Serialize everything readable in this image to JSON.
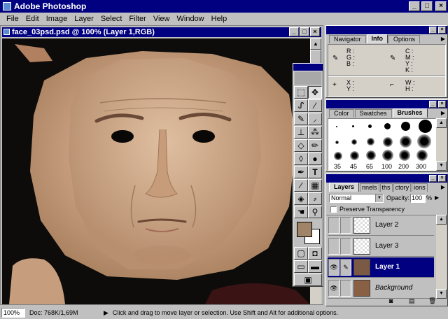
{
  "app": {
    "title": "Adobe Photoshop",
    "min": "_",
    "max": "□",
    "close": "×"
  },
  "menu": [
    "File",
    "Edit",
    "Image",
    "Layer",
    "Select",
    "Filter",
    "View",
    "Window",
    "Help"
  ],
  "document": {
    "title": "face_03psd.psd @ 100% (Layer 1,RGB)"
  },
  "navigator_panel": {
    "tabs": [
      "Navigator",
      "Info",
      "Options"
    ],
    "active_tab": "Info",
    "rgb_labels": [
      "R :",
      "G :",
      "B :"
    ],
    "cmyk_labels": [
      "C :",
      "M :",
      "Y :",
      "K :"
    ],
    "xy_labels": [
      "X :",
      "Y :"
    ],
    "wh_labels": [
      "W :",
      "H :"
    ]
  },
  "brushes_panel": {
    "tabs": [
      "Color",
      "Swatches",
      "Brushes"
    ],
    "active_tab": "Brushes",
    "sizes": [
      "35",
      "45",
      "65",
      "100",
      "200",
      "300"
    ]
  },
  "layers_panel": {
    "tabs": [
      "Layers",
      "nnels",
      "ths",
      "ctory",
      "ions"
    ],
    "active_tab": "Layers",
    "blend_mode": "Normal",
    "opacity_label": "Opacity:",
    "opacity_value": "100",
    "opacity_unit": "%",
    "preserve_label": "Preserve Transparency",
    "layers": [
      {
        "name": "Layer 2",
        "visible": false,
        "selected": false
      },
      {
        "name": "Layer 3",
        "visible": false,
        "selected": false
      },
      {
        "name": "Layer 1",
        "visible": true,
        "selected": true
      },
      {
        "name": "Background",
        "visible": true,
        "selected": false
      }
    ]
  },
  "status": {
    "zoom": "100%",
    "doc": "Doc: 768K/1,69M",
    "message": "Click and drag to move layer or selection. Use Shift and Alt for additional options."
  },
  "colors": {
    "titlebar": "#000080",
    "chrome": "#c0c0c0",
    "foreground_swatch": "#a08468"
  }
}
